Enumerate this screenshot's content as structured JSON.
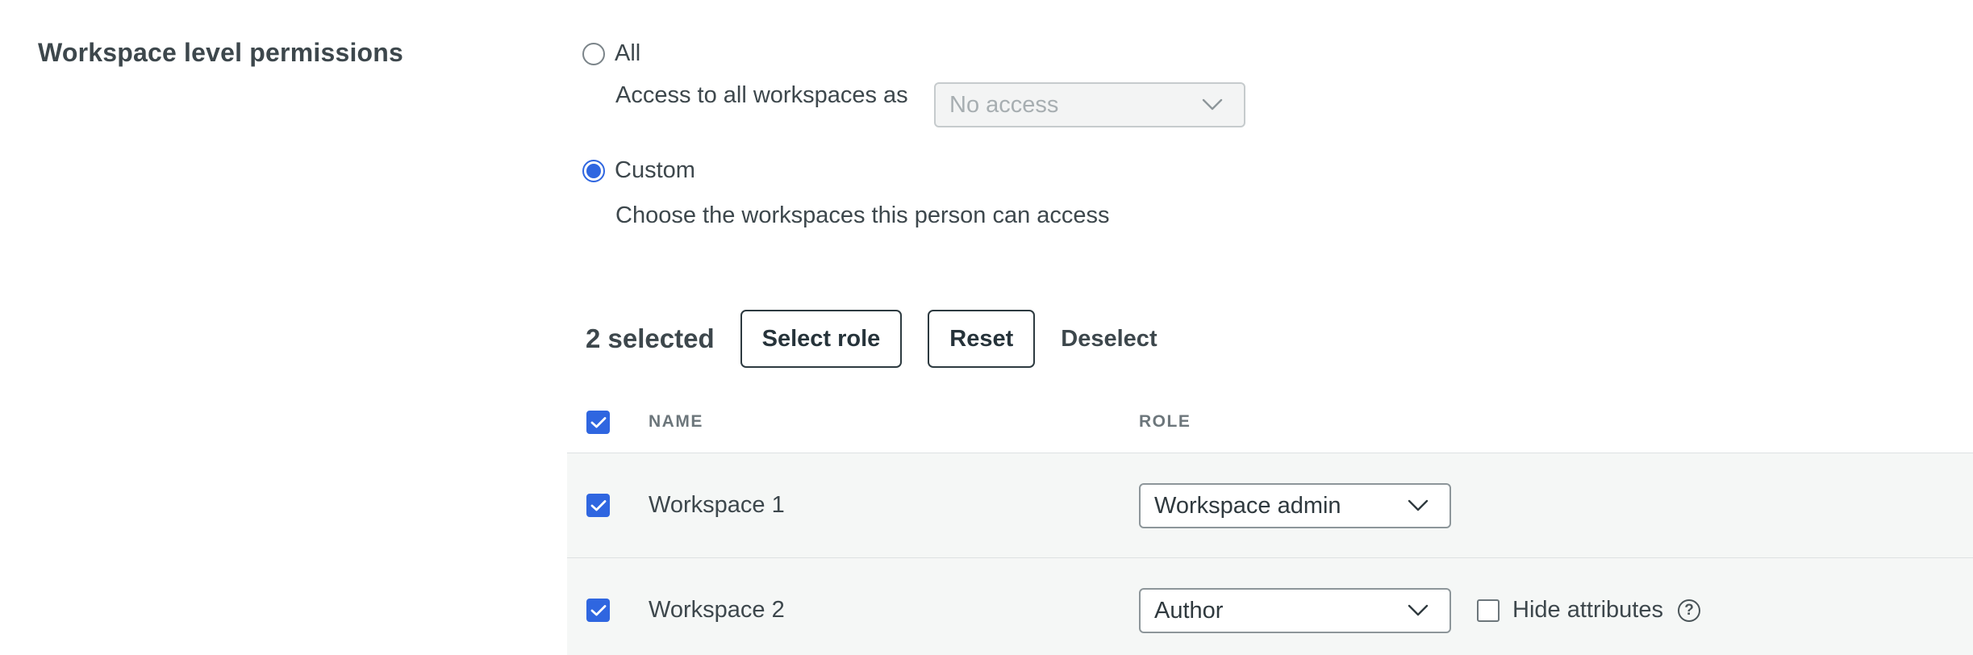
{
  "section": {
    "title": "Workspace level permissions"
  },
  "options": {
    "all": {
      "label": "All",
      "checked": false,
      "access_label": "Access to all workspaces as",
      "access_select_value": "No access"
    },
    "custom": {
      "label": "Custom",
      "checked": true,
      "description": "Choose the workspaces this person can access"
    }
  },
  "bulk": {
    "selected_count": "2 selected",
    "select_role_label": "Select role",
    "reset_label": "Reset",
    "deselect_label": "Deselect"
  },
  "table": {
    "headers": {
      "name": "NAME",
      "role": "ROLE"
    },
    "rows": [
      {
        "name": "Workspace 1",
        "role": "Workspace admin",
        "checked": true
      },
      {
        "name": "Workspace 2",
        "role": "Author",
        "checked": true,
        "hide_attributes_label": "Hide attributes",
        "hide_attributes_checked": false,
        "help_icon": "question-circle-icon"
      }
    ]
  },
  "colors": {
    "accent": "#2f66e0",
    "row_bg": "#f5f7f6",
    "text": "#3d474c"
  }
}
